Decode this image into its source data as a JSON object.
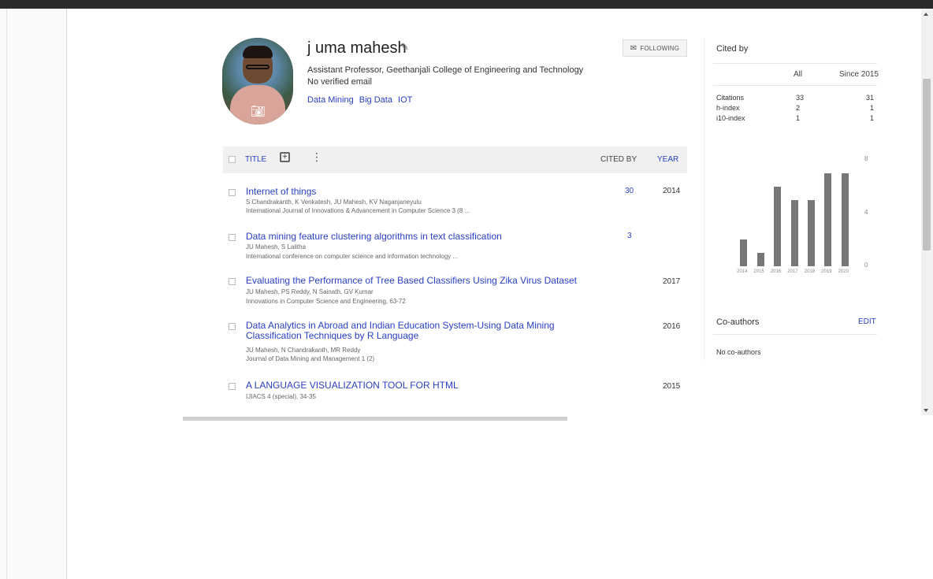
{
  "profile": {
    "name": "j uma mahesh",
    "affiliation": "Assistant Professor, Geethanjali College of Engineering and Technology",
    "email": "No verified email",
    "interests": [
      "Data Mining",
      "Big Data",
      "IOT"
    ],
    "follow_label": "FOLLOWING"
  },
  "table": {
    "header": {
      "title": "TITLE",
      "cited_by": "CITED BY",
      "year": "YEAR"
    },
    "rows": [
      {
        "title": "Internet of things",
        "authors": "S Chandrakanth, K Venkatesh, JU Mahesh, KV Naganjaneyulu",
        "venue": "International Journal of Innovations & Advancement in Computer Science 3 (8 ...",
        "cited": "30",
        "year": "2014"
      },
      {
        "title": "Data mining feature clustering algorithms in text classification",
        "authors": "JU Mahesh, S Lalitha",
        "venue": "International conference on computer science and information technology ...",
        "cited": "3",
        "year": ""
      },
      {
        "title": "Evaluating the Performance of Tree Based Classifiers Using Zika Virus Dataset",
        "authors": "JU Mahesh, PS Reddy, N Sainath, GV Kumar",
        "venue": "Innovations in Computer Science and Engineering, 63-72",
        "cited": "",
        "year": "2017"
      },
      {
        "title": "Data Analytics in Abroad and Indian Education System-Using Data Mining Classification Techniques by R Language",
        "authors": "JU Mahesh, N Chandrakanth, MR Reddy",
        "venue": "Journal of Data Mining and Management 1 (2)",
        "cited": "",
        "year": "2016"
      },
      {
        "title": "A LANGUAGE VISUALIZATION TOOL FOR HTML",
        "authors": "IJIACS 4 (special), 34-35",
        "venue": "",
        "cited": "",
        "year": "2015"
      }
    ]
  },
  "cited_by": {
    "title": "Cited by",
    "col_all": "All",
    "col_since": "Since 2015",
    "stats": [
      {
        "label": "Citations",
        "all": "33",
        "since": "31"
      },
      {
        "label": "h-index",
        "all": "2",
        "since": "1"
      },
      {
        "label": "i10-index",
        "all": "1",
        "since": "1"
      }
    ]
  },
  "chart_data": {
    "type": "bar",
    "categories": [
      "2014",
      "2015",
      "2016",
      "2017",
      "2018",
      "2019",
      "2020"
    ],
    "values": [
      2,
      1,
      6,
      5,
      5,
      7,
      7
    ],
    "ylim": [
      0,
      8
    ],
    "yticks": [
      "8",
      "4",
      "0"
    ],
    "title": "",
    "xlabel": "",
    "ylabel": "",
    "bar_color": "#777777"
  },
  "coauthors": {
    "title": "Co-authors",
    "edit_label": "EDIT",
    "empty_text": "No co-authors"
  },
  "colors": {
    "link": "#2a40c4",
    "topbar": "#2b2b2b"
  },
  "icons": {
    "edit": "pencil-icon",
    "camera": "camera-icon",
    "follow": "mail-icon",
    "add": "add-box-icon",
    "more": "more-vert-icon"
  }
}
